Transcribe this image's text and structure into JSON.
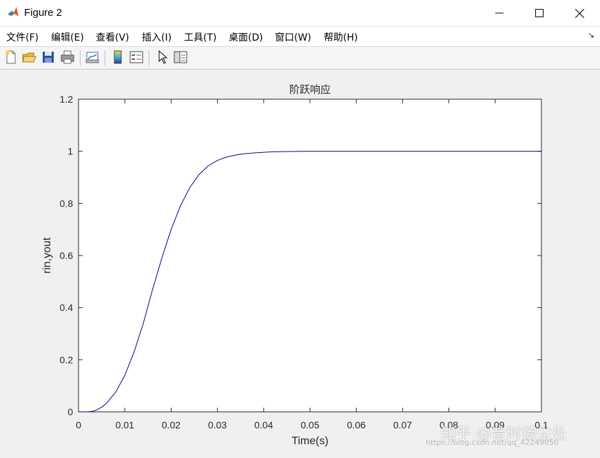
{
  "window": {
    "title": "Figure 2",
    "controls": {
      "minimize": "—",
      "maximize": "☐",
      "close": "✕"
    }
  },
  "menu": {
    "items": [
      "文件(F)",
      "编辑(E)",
      "查看(V)",
      "插入(I)",
      "工具(T)",
      "桌面(D)",
      "窗口(W)",
      "帮助(H)"
    ],
    "more": "↘"
  },
  "toolbar": {
    "buttons": [
      "new-figure-icon",
      "open-file-icon",
      "save-icon",
      "print-icon",
      "link-plot-icon",
      "colorbar-icon",
      "legend-icon",
      "pointer-icon",
      "property-editor-icon"
    ]
  },
  "chart_data": {
    "type": "line",
    "title": "阶跃响应",
    "xlabel": "Time(s)",
    "ylabel": "rin,yout",
    "xlim": [
      0,
      0.1
    ],
    "ylim": [
      0,
      1.2
    ],
    "xticks": [
      "0",
      "0.01",
      "0.02",
      "0.03",
      "0.04",
      "0.05",
      "0.06",
      "0.07",
      "0.08",
      "0.09",
      "0.1"
    ],
    "yticks": [
      "0",
      "0.2",
      "0.4",
      "0.6",
      "0.8",
      "1",
      "1.2"
    ],
    "grid": false,
    "line_color": "#00008b",
    "series": [
      {
        "x": [
          0,
          0.002,
          0.003,
          0.004,
          0.005,
          0.006,
          0.008,
          0.01,
          0.012,
          0.014,
          0.016,
          0.018,
          0.02,
          0.022,
          0.024,
          0.026,
          0.028,
          0.03,
          0.032,
          0.034,
          0.036,
          0.038,
          0.04,
          0.042,
          0.045,
          0.05,
          0.055,
          0.06,
          0.07,
          0.08,
          0.09,
          0.1
        ],
        "y": [
          0,
          0,
          0.002,
          0.008,
          0.018,
          0.032,
          0.075,
          0.14,
          0.23,
          0.34,
          0.47,
          0.59,
          0.7,
          0.79,
          0.86,
          0.91,
          0.944,
          0.965,
          0.978,
          0.986,
          0.991,
          0.994,
          0.996,
          0.998,
          0.999,
          1.0,
          1.0,
          1.0,
          1.0,
          1.0,
          1.0,
          1.0
        ]
      }
    ]
  },
  "watermark": {
    "text": "知乎 @昔时扬尘处",
    "url": "https://blog.csdn.net/qq_42249050"
  }
}
